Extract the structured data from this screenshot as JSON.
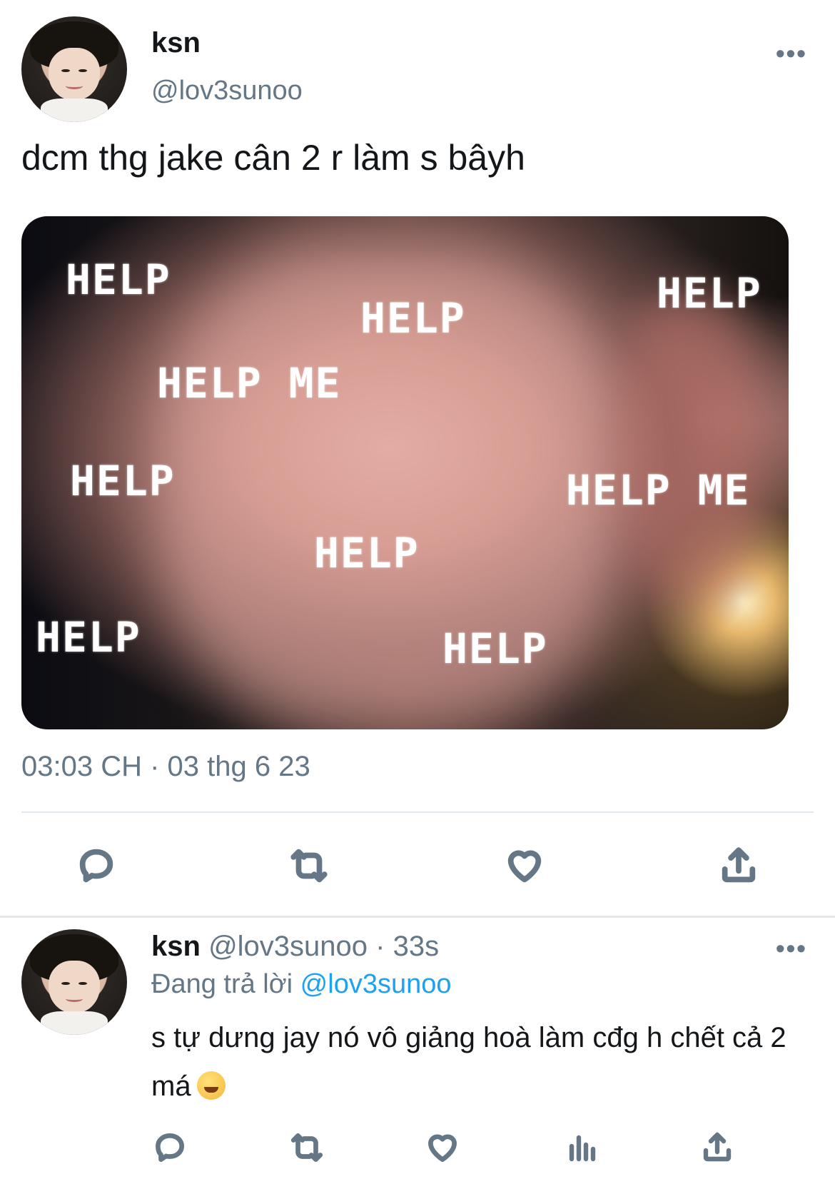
{
  "tweet": {
    "display_name": "ksn",
    "handle": "@lov3sunoo",
    "more_label": "•••",
    "text": "dcm thg jake cân 2 r làm s bâyh",
    "media_overlay": [
      "HELP",
      "HELP",
      "HELP",
      "HELP ME",
      "HELP",
      "HELP ME",
      "HELP",
      "HELP",
      "HELP"
    ],
    "timestamp": "03:03 CH · 03 thg 6 23",
    "actions": [
      "reply-icon",
      "retweet-icon",
      "like-icon",
      "share-icon"
    ]
  },
  "reply": {
    "display_name": "ksn",
    "handle_time": "@lov3sunoo · 33s",
    "replying_prefix": "Đang trả lời",
    "replying_mention": "@lov3sunoo",
    "text": "s tự dưng jay nó vô giảng hoà làm cđg h chết cả 2 má",
    "emoji": "grinning-face-with-sweat",
    "more_label": "•••",
    "actions": [
      "reply-icon",
      "retweet-icon",
      "like-icon",
      "analytics-icon",
      "share-icon"
    ]
  },
  "colors": {
    "text": "#14171a",
    "secondary": "#657786",
    "link": "#1da1f2",
    "divider": "#e1e8ed"
  }
}
